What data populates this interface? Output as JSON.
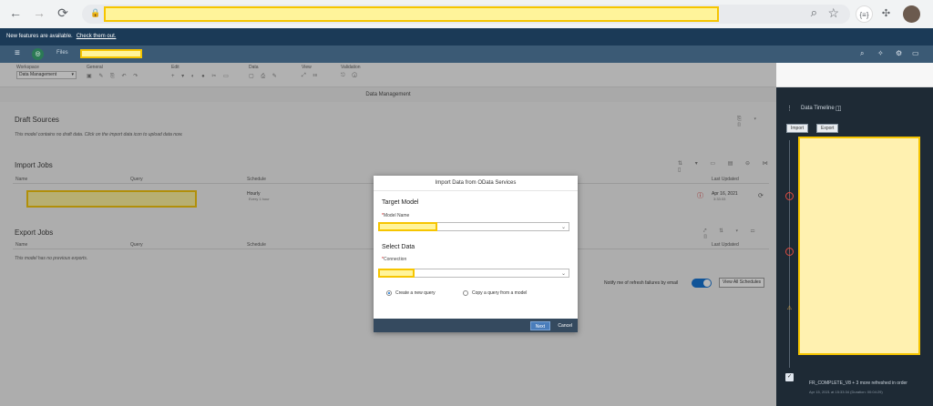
{
  "infobar": {
    "text": "New features are available.",
    "link": "Check them out."
  },
  "shell": {
    "files": "Files"
  },
  "toolbar": {
    "workspace_label": "Workspace",
    "workspace_value": "Data Management",
    "general_label": "General",
    "edit_label": "Edit",
    "data_label": "Data",
    "view_label": "View",
    "validation_label": "Validation"
  },
  "main": {
    "title": "Data Management",
    "draft": {
      "title": "Draft Sources",
      "note": "This model contains no draft data. Click on the import data icon to upload data now."
    },
    "import": {
      "title": "Import Jobs",
      "columns": [
        "Name",
        "Query",
        "Schedule",
        "Last Updated"
      ],
      "row": {
        "schedule": "Hourly",
        "schedule_sub": "Every 1 hour",
        "updated": "Apr 16, 2021",
        "updated_time": "3:33:33"
      }
    },
    "export": {
      "title": "Export Jobs",
      "columns": [
        "Name",
        "Query",
        "Schedule",
        "Last Updated"
      ],
      "note": "This model has no previous exports."
    },
    "notify_label": "Notify me of refresh failures by email",
    "view_schedules": "View All Schedules"
  },
  "panel": {
    "title": "Data Timeline",
    "import_btn": "Import",
    "export_btn": "Export",
    "bottom_text": "FR_COMPLETE_V8 + 3 more refreshed in order",
    "bottom_time": "Apr 15, 2021 at 15:33:34 (Duration: 00:04:29)"
  },
  "dialog": {
    "title": "Import Data from OData Services",
    "target_heading": "Target Model",
    "model_label": "Model Name",
    "select_heading": "Select Data",
    "connection_label": "Connection",
    "option_new": "Create a new query",
    "option_copy": "Copy a query from a model",
    "next": "Next",
    "cancel": "Cancel"
  }
}
